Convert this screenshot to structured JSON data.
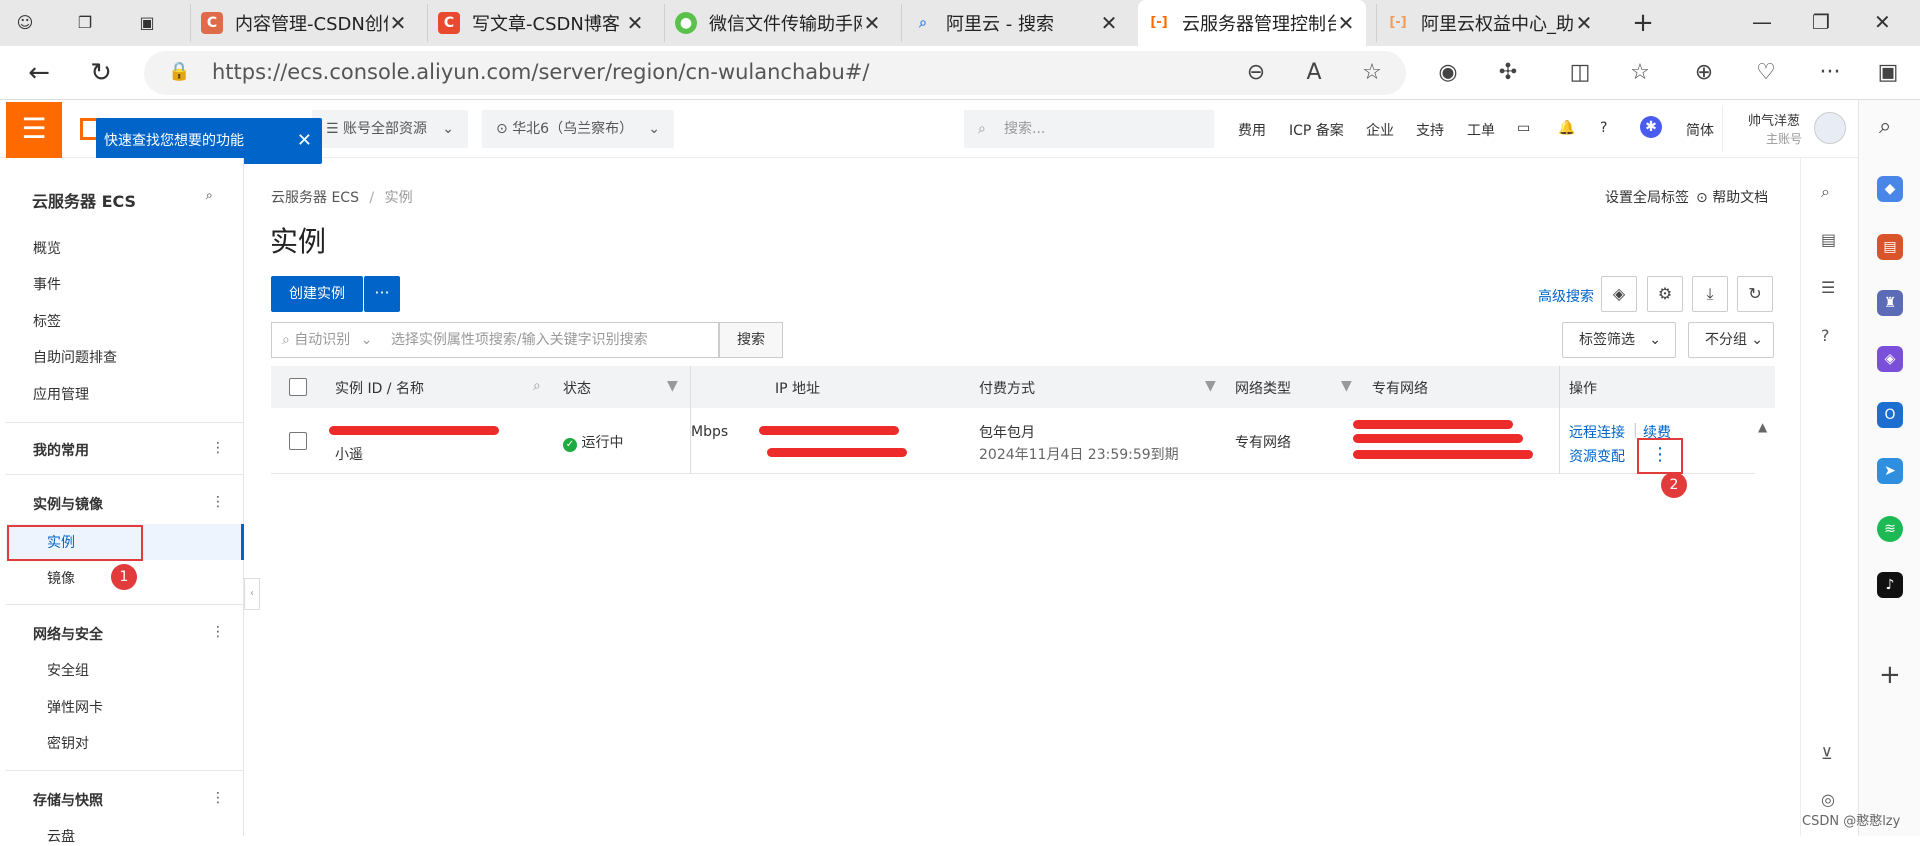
{
  "browser": {
    "tabs": [
      {
        "title": "内容管理-CSDN创作中心",
        "color": "#e06b4a",
        "glyph": "C"
      },
      {
        "title": "写文章-CSDN博客",
        "color": "#e8492f",
        "glyph": "C"
      },
      {
        "title": "微信文件传输助手网页版",
        "color": "#5ac24a",
        "glyph": "✉"
      },
      {
        "title": "阿里云 - 搜索",
        "color": "#4a86e8",
        "glyph": "⌕"
      },
      {
        "title": "云服务器管理控制台",
        "color": "#ff6a00",
        "glyph": "[-]"
      },
      {
        "title": "阿里云权益中心_助力",
        "color": "#f39c5a",
        "glyph": "[-]"
      }
    ],
    "active_tab_index": 4,
    "url": "https://ecs.console.aliyun.com/server/region/cn-wulanchabu#/"
  },
  "header": {
    "menu_icon": "hamburger-icon",
    "account_select": "账号全部资源",
    "region_select": "华北6（乌兰察布）",
    "search_placeholder": "搜索...",
    "links": [
      "费用",
      "ICP 备案",
      "企业",
      "支持",
      "工单"
    ],
    "lang": "简体",
    "user_name": "帅气洋葱",
    "user_role": "主账号"
  },
  "tooltip": {
    "text": "快速查找您想要的功能"
  },
  "sidebar": {
    "title": "云服务器 ECS",
    "top_items": [
      "概览",
      "事件",
      "标签",
      "自助问题排查",
      "应用管理"
    ],
    "groups": [
      {
        "label": "我的常用",
        "items": []
      },
      {
        "label": "实例与镜像",
        "items": [
          "实例",
          "镜像"
        ]
      },
      {
        "label": "网络与安全",
        "items": [
          "安全组",
          "弹性网卡",
          "密钥对"
        ]
      },
      {
        "label": "存储与快照",
        "items": [
          "云盘"
        ]
      }
    ],
    "badge1": "1"
  },
  "main": {
    "breadcrumb": [
      "云服务器 ECS",
      "实例"
    ],
    "page_title": "实例",
    "set_tag": "设置全局标签",
    "help_doc": "帮助文档",
    "create_button": "创建实例",
    "more_button": "···",
    "search_mode": "自动识别",
    "search_placeholder": "选择实例属性项搜索/输入关键字识别搜索",
    "search_button": "搜索",
    "advanced_search": "高级搜索",
    "tag_filter": "标签筛选",
    "group_select": "不分组",
    "columns": {
      "id_name": "实例 ID / 名称",
      "status": "状态",
      "ip": "IP 地址",
      "billing": "付费方式",
      "network": "网络类型",
      "vpc": "专有网络",
      "actions": "操作"
    },
    "row": {
      "name": "小遥",
      "status": "运行中",
      "bandwidth_suffix": "Mbps",
      "billing": "包年包月",
      "expire": "2024年11月4日 23:59:59到期",
      "network": "专有网络",
      "action_remote": "远程连接",
      "action_renew": "续费",
      "action_resize": "资源变配",
      "more_icon": "⋮"
    },
    "badge2": "2"
  },
  "watermark": "CSDN @憨憨lzy"
}
